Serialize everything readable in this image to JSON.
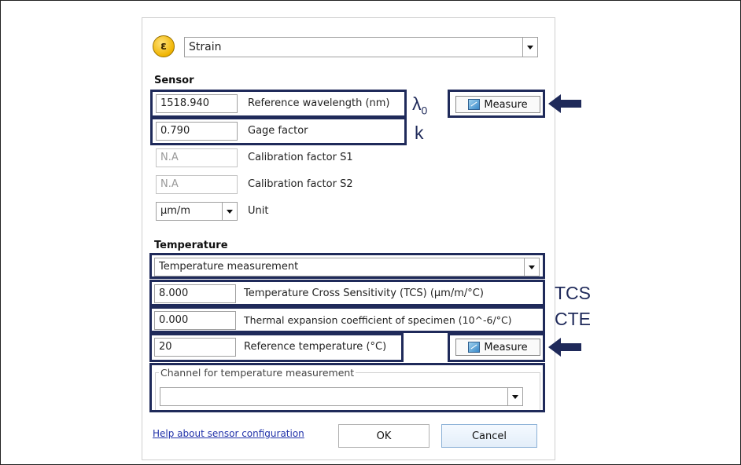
{
  "type_selector": {
    "icon_glyph": "ε",
    "value": "Strain"
  },
  "sensor": {
    "heading": "Sensor",
    "reference_wavelength": {
      "value": "1518.940",
      "label": "Reference wavelength (nm)",
      "annotation": "λ",
      "annotation_sub": "0"
    },
    "gage_factor": {
      "value": "0.790",
      "label": "Gage factor",
      "annotation": "k"
    },
    "calibration_s1": {
      "value": "N.A",
      "label": "Calibration factor S1"
    },
    "calibration_s2": {
      "value": "N.A",
      "label": "Calibration factor S2"
    },
    "unit": {
      "value": "µm/m",
      "label": "Unit"
    },
    "measure_label": "Measure"
  },
  "temperature": {
    "heading": "Temperature",
    "mode": "Temperature measurement",
    "tcs": {
      "value": "8.000",
      "label": "Temperature Cross Sensitivity (TCS) (µm/m/°C)",
      "annotation": "TCS"
    },
    "cte": {
      "value": "0.000",
      "label": "Thermal expansion coefficient of specimen (10^-6/°C)",
      "annotation": "CTE"
    },
    "reference_temperature": {
      "value": "20",
      "label": "Reference temperature (°C)"
    },
    "measure_label": "Measure",
    "channel": {
      "legend": "Channel for temperature measurement",
      "value": ""
    }
  },
  "footer": {
    "help_link": "Help about sensor configuration",
    "ok": "OK",
    "cancel": "Cancel"
  },
  "colors": {
    "highlight": "#1f2a5a",
    "link": "#2233aa",
    "icon_gold": "#f0b400"
  },
  "icons": {
    "type_icon": "epsilon-icon",
    "measure_icon": "chart-icon",
    "pointer": "arrow-left-icon"
  }
}
